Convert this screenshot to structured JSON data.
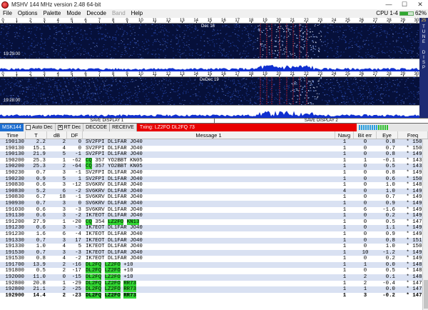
{
  "window": {
    "title": "MSHV 144 MHz version 2.48 64-bit",
    "minimize": "—",
    "maximize": "☐",
    "close": "✕"
  },
  "menu": {
    "items": [
      {
        "label": "File",
        "enabled": true
      },
      {
        "label": "Options",
        "enabled": true
      },
      {
        "label": "Palette",
        "enabled": true
      },
      {
        "label": "Mode",
        "enabled": true
      },
      {
        "label": "Decode",
        "enabled": true
      },
      {
        "label": "Band",
        "enabled": false
      },
      {
        "label": "Help",
        "enabled": true
      }
    ],
    "cpu_label": "CPU 1-4",
    "cpu_percent": "62%",
    "cpu_fraction": 0.62
  },
  "scale_ticks": [
    "0",
    "1",
    "2",
    "3",
    "4",
    "5",
    "6",
    "7",
    "8",
    "9",
    "10",
    "11",
    "12",
    "13",
    "14",
    "15",
    "16",
    "17",
    "18",
    "19",
    "20",
    "21",
    "22",
    "23",
    "24",
    "25",
    "26",
    "27",
    "28",
    "29",
    "30"
  ],
  "display1": {
    "stamp": "19:29:00",
    "day_mark": "Dec 16"
  },
  "display2": {
    "stamp": "19:28:00",
    "day_mark": "DeDec 19"
  },
  "sidebar": {
    "top_value": "25",
    "tune": [
      "T",
      "U",
      "N",
      "E"
    ],
    "disp": [
      "D",
      "I",
      "S",
      "P"
    ]
  },
  "save_buttons": {
    "one": "SAVE DISPLAY 1",
    "two": "SAVE DISPLAY 2"
  },
  "toolbar": {
    "mode": "MSK144",
    "auto_dec": "Auto Dec",
    "rt_dec": "RT Dec",
    "rt_dec_mark": "✕",
    "decode": "DECODE",
    "receive": "RECEIVE",
    "txing": "Txing: LZ2FO DL2FQ 73"
  },
  "colors": {
    "accent_blue": "#1e6fd1",
    "tx_red": "#e80000",
    "cq_green": "#33d633",
    "row_alt": "#d9e1f2",
    "waterfall_bg": "#06103a"
  },
  "table": {
    "headers": {
      "time": "Time",
      "t": "T",
      "db": "dB",
      "df": "DF",
      "message": "Message 1",
      "navg": "Navg",
      "bit_err": "Bit err",
      "eye": "Eye",
      "freq": "Freq"
    },
    "rows": [
      {
        "time": "190130",
        "t": "2.2",
        "db": "2",
        "df": "0",
        "msg": [
          {
            "t": "SV2FPI DL1FAR JO40"
          }
        ],
        "navg": "1",
        "bit": "0",
        "eye": "0.8",
        "freq": "* 1500"
      },
      {
        "time": "190130",
        "t": "15.1",
        "db": "4",
        "df": "0",
        "msg": [
          {
            "t": "SV2FPI DL1FAR JO40"
          }
        ],
        "navg": "1",
        "bit": "0",
        "eye": "0.7",
        "freq": "* 1500"
      },
      {
        "time": "190130",
        "t": "21.9",
        "db": "5",
        "df": "-1",
        "msg": [
          {
            "t": "SV2FPI DL1FAR JO40"
          }
        ],
        "navg": "1",
        "bit": "0",
        "eye": "0.8",
        "freq": "* 1498"
      },
      {
        "time": "190200",
        "t": "25.3",
        "db": "1",
        "df": "-62",
        "msg": [
          {
            "t": "CQ",
            "h": true
          },
          {
            "t": " 357 YO2BBT KN05"
          }
        ],
        "navg": "1",
        "bit": "1",
        "eye": "-0.1",
        "freq": "* 1437"
      },
      {
        "time": "190200",
        "t": "25.3",
        "db": "2",
        "df": "-64",
        "msg": [
          {
            "t": "CQ",
            "h": true
          },
          {
            "t": " 357 YO2BBT KN05"
          }
        ],
        "navg": "1",
        "bit": "0",
        "eye": "0.5",
        "freq": "* 1435"
      },
      {
        "time": "190230",
        "t": "0.7",
        "db": "3",
        "df": "-1",
        "msg": [
          {
            "t": "SV2FPI DL1FAR JO40"
          }
        ],
        "navg": "1",
        "bit": "0",
        "eye": "0.8",
        "freq": "* 1498"
      },
      {
        "time": "190230",
        "t": "0.9",
        "db": "5",
        "df": "1",
        "msg": [
          {
            "t": "SV2FPI DL1FAR JO40"
          }
        ],
        "navg": "1",
        "bit": "0",
        "eye": "0.6",
        "freq": "* 1501"
      },
      {
        "time": "190830",
        "t": "0.6",
        "db": "3",
        "df": "-12",
        "msg": [
          {
            "t": "SV6KRV DL1FAR JO40"
          }
        ],
        "navg": "1",
        "bit": "0",
        "eye": "1.0",
        "freq": "* 1487"
      },
      {
        "time": "190830",
        "t": "5.2",
        "db": "6",
        "df": "-2",
        "msg": [
          {
            "t": "SV6KRV DL1FAR JO40"
          }
        ],
        "navg": "4",
        "bit": "0",
        "eye": "1.0",
        "freq": "* 1497"
      },
      {
        "time": "190830",
        "t": "6.7",
        "db": "18",
        "df": "-1",
        "msg": [
          {
            "t": "SV6KRV DL1FAR JO40"
          }
        ],
        "navg": "1",
        "bit": "0",
        "eye": "0.7",
        "freq": "* 1498"
      },
      {
        "time": "190930",
        "t": "0.7",
        "db": "3",
        "df": "0",
        "msg": [
          {
            "t": "SV6KRV DL1FAR JO40"
          }
        ],
        "navg": "1",
        "bit": "0",
        "eye": "0.9",
        "freq": "* 1499"
      },
      {
        "time": "191030",
        "t": "0.6",
        "db": "3",
        "df": "-3",
        "msg": [
          {
            "t": "SV6KRV DL1FAR JO40"
          }
        ],
        "navg": "1",
        "bit": "6",
        "eye": "-1.6",
        "freq": "* 1496"
      },
      {
        "time": "191130",
        "t": "0.6",
        "db": "3",
        "df": "-2",
        "msg": [
          {
            "t": "IK7EOT DL1FAR JO40"
          }
        ],
        "navg": "1",
        "bit": "0",
        "eye": "0.2",
        "freq": "* 1497"
      },
      {
        "time": "191200",
        "t": "27.9",
        "db": "1",
        "df": "-20",
        "msg": [
          {
            "t": "CQ",
            "h": true
          },
          {
            "t": " 354 "
          },
          {
            "t": "LZ2FO",
            "h": true
          },
          {
            "t": " "
          },
          {
            "t": "KN13",
            "h": true
          }
        ],
        "navg": "1",
        "bit": "0",
        "eye": "0.5",
        "freq": "* 1479"
      },
      {
        "time": "191230",
        "t": "0.6",
        "db": "3",
        "df": "-3",
        "msg": [
          {
            "t": "IK7EOT DL1FAR JO40"
          }
        ],
        "navg": "1",
        "bit": "0",
        "eye": "1.1",
        "freq": "* 1496"
      },
      {
        "time": "191230",
        "t": "1.6",
        "db": "6",
        "df": "-4",
        "msg": [
          {
            "t": "IK7EOT DL1FAR JO40"
          }
        ],
        "navg": "1",
        "bit": "0",
        "eye": "0.9",
        "freq": "* 1495"
      },
      {
        "time": "191330",
        "t": "0.7",
        "db": "3",
        "df": "17",
        "msg": [
          {
            "t": "IK7EOT DL1FAR JO40"
          }
        ],
        "navg": "1",
        "bit": "0",
        "eye": "0.8",
        "freq": "* 1517"
      },
      {
        "time": "191330",
        "t": "1.0",
        "db": "4",
        "df": "5",
        "msg": [
          {
            "t": "IK7EOT DL1FAR JO40"
          }
        ],
        "navg": "1",
        "bit": "0",
        "eye": "1.0",
        "freq": "* 1505"
      },
      {
        "time": "191530",
        "t": "0.7",
        "db": "3",
        "df": "-3",
        "msg": [
          {
            "t": "IK7EOT DL1FAR JO40"
          }
        ],
        "navg": "1",
        "bit": "10",
        "eye": "-1.2",
        "freq": "* 1496"
      },
      {
        "time": "191530",
        "t": "0.8",
        "db": "4",
        "df": "-2",
        "msg": [
          {
            "t": "IK7EOT DL1FAR JO40"
          }
        ],
        "navg": "1",
        "bit": "0",
        "eye": "0.2",
        "freq": "* 1497"
      },
      {
        "time": "191700",
        "t": "13.9",
        "db": "2",
        "df": "-16",
        "msg": [
          {
            "t": "DL2FQ",
            "h": true
          },
          {
            "t": " "
          },
          {
            "t": "LZ2FO",
            "h": true
          },
          {
            "t": " +10"
          }
        ],
        "navg": "1",
        "bit": "1",
        "eye": "0.0",
        "freq": "* 1483"
      },
      {
        "time": "191800",
        "t": "0.5",
        "db": "2",
        "df": "-17",
        "msg": [
          {
            "t": "DL2FQ",
            "h": true
          },
          {
            "t": " "
          },
          {
            "t": "LZ2FO",
            "h": true
          },
          {
            "t": " +10"
          }
        ],
        "navg": "1",
        "bit": "0",
        "eye": "0.5",
        "freq": "* 1482"
      },
      {
        "time": "192000",
        "t": "11.0",
        "db": "0",
        "df": "-15",
        "msg": [
          {
            "t": "DL2FQ",
            "h": true
          },
          {
            "t": " "
          },
          {
            "t": "LZ2FO",
            "h": true
          },
          {
            "t": " +10"
          }
        ],
        "navg": "1",
        "bit": "2",
        "eye": "0.1",
        "freq": "* 1484"
      },
      {
        "time": "192800",
        "t": "20.8",
        "db": "1",
        "df": "-29",
        "msg": [
          {
            "t": "DL2FQ",
            "h": true
          },
          {
            "t": " "
          },
          {
            "t": "LZ2FO",
            "h": true
          },
          {
            "t": " "
          },
          {
            "t": "RR73",
            "h": true
          }
        ],
        "navg": "1",
        "bit": "2",
        "eye": "-0.4",
        "freq": "* 1470"
      },
      {
        "time": "192800",
        "t": "21.1",
        "db": "2",
        "df": "-25",
        "msg": [
          {
            "t": "DL2FQ",
            "h": true
          },
          {
            "t": " "
          },
          {
            "t": "LZ2FO",
            "h": true
          },
          {
            "t": " "
          },
          {
            "t": "RR73",
            "h": true
          }
        ],
        "navg": "1",
        "bit": "1",
        "eye": "0.0",
        "freq": "* 1474"
      },
      {
        "time": "192900",
        "t": "14.4",
        "db": "2",
        "df": "-23",
        "msg": [
          {
            "t": "DL2FQ",
            "h": true
          },
          {
            "t": " "
          },
          {
            "t": "LZ2FO",
            "h": true
          },
          {
            "t": " "
          },
          {
            "t": "RR73",
            "h": true
          }
        ],
        "navg": "1",
        "bit": "3",
        "eye": "-0.2",
        "freq": "* 1476",
        "bold": true
      }
    ]
  }
}
